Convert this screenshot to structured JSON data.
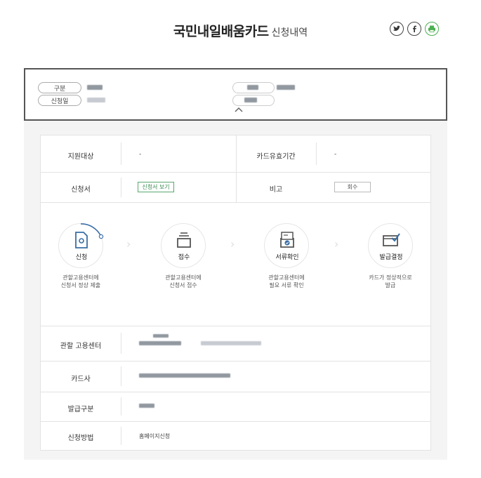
{
  "page": {
    "title": "국민내일배움카드",
    "subtitle": "신청내역"
  },
  "share": {
    "icons": [
      "twitter-icon",
      "facebook-icon",
      "print-icon"
    ],
    "accent": "#4caf50"
  },
  "summary": {
    "type_label": "구분",
    "date_label": "신청일"
  },
  "info": {
    "target_label": "지원대상",
    "target_value": "-",
    "validity_label": "카드유효기간",
    "validity_value": "-",
    "form_label": "신청서",
    "form_button": "신청서 보기",
    "note_label": "비고",
    "note_button": "회수"
  },
  "steps": [
    {
      "label": "신청",
      "desc1": "관할고용센터에",
      "desc2": "신청서 정상 제출",
      "icon": "document-icon"
    },
    {
      "label": "접수",
      "desc1": "관할고용센터에",
      "desc2": "신청서 접수",
      "icon": "tray-icon"
    },
    {
      "label": "서류확인",
      "desc1": "관할고용센터에",
      "desc2": "필요 서류 확인",
      "icon": "document-check-icon"
    },
    {
      "label": "발급결정",
      "desc1": "카드가 정상적으로",
      "desc2": "발급",
      "icon": "card-check-icon"
    }
  ],
  "details": {
    "center_label": "관할 고용센터",
    "card_label": "카드사",
    "issue_label": "발급구분",
    "method_label": "신청방법",
    "method_value": "홈페이지신청"
  },
  "colors": {
    "accent_green": "#3b8a52",
    "active_blue": "#3a6ea5"
  }
}
